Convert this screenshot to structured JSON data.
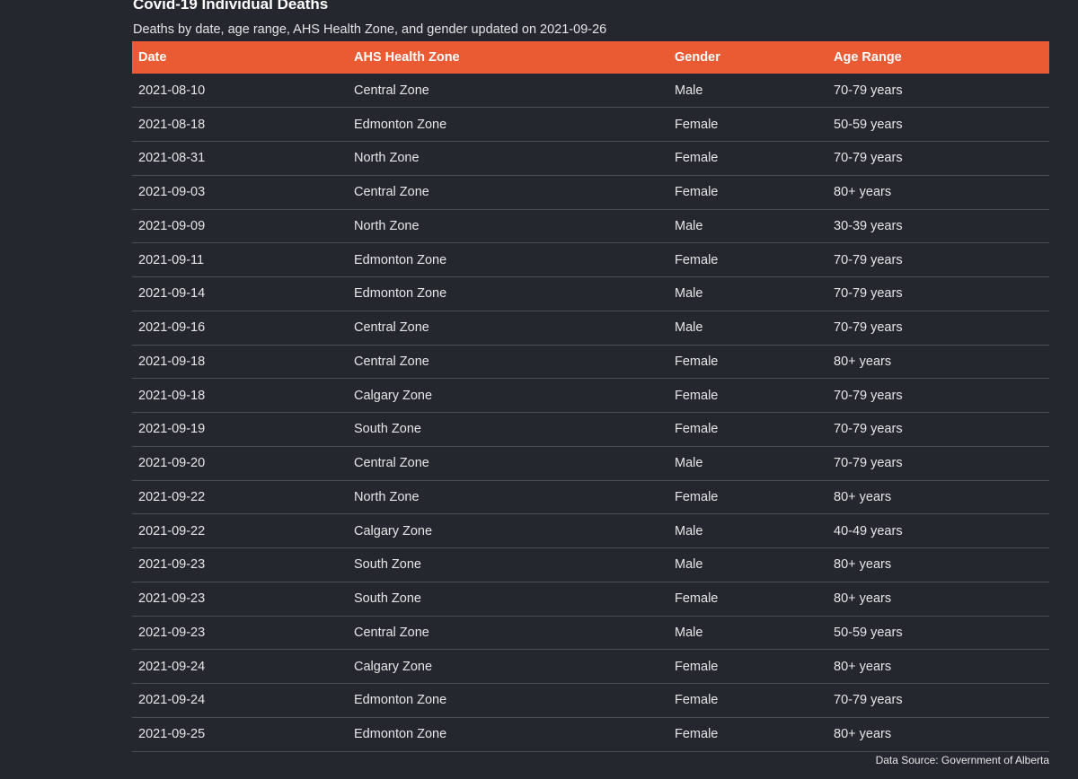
{
  "header": {
    "title": "Covid-19 Individual Deaths",
    "subtitle": "Deaths by date, age range, AHS Health Zone, and gender updated on 2021-09-26"
  },
  "table": {
    "columns": [
      "Date",
      "AHS Health Zone",
      "Gender",
      "Age Range"
    ],
    "rows": [
      [
        "2021-08-10",
        "Central Zone",
        "Male",
        "70-79 years"
      ],
      [
        "2021-08-18",
        "Edmonton Zone",
        "Female",
        "50-59 years"
      ],
      [
        "2021-08-31",
        "North Zone",
        "Female",
        "70-79 years"
      ],
      [
        "2021-09-03",
        "Central Zone",
        "Female",
        "80+ years"
      ],
      [
        "2021-09-09",
        "North Zone",
        "Male",
        "30-39 years"
      ],
      [
        "2021-09-11",
        "Edmonton Zone",
        "Female",
        "70-79 years"
      ],
      [
        "2021-09-14",
        "Edmonton Zone",
        "Male",
        "70-79 years"
      ],
      [
        "2021-09-16",
        "Central Zone",
        "Male",
        "70-79 years"
      ],
      [
        "2021-09-18",
        "Central Zone",
        "Female",
        "80+ years"
      ],
      [
        "2021-09-18",
        "Calgary Zone",
        "Female",
        "70-79 years"
      ],
      [
        "2021-09-19",
        "South Zone",
        "Female",
        "70-79 years"
      ],
      [
        "2021-09-20",
        "Central Zone",
        "Male",
        "70-79 years"
      ],
      [
        "2021-09-22",
        "North Zone",
        "Female",
        "80+ years"
      ],
      [
        "2021-09-22",
        "Calgary Zone",
        "Male",
        "40-49 years"
      ],
      [
        "2021-09-23",
        "South Zone",
        "Male",
        "80+ years"
      ],
      [
        "2021-09-23",
        "South Zone",
        "Female",
        "80+ years"
      ],
      [
        "2021-09-23",
        "Central Zone",
        "Male",
        "50-59 years"
      ],
      [
        "2021-09-24",
        "Calgary Zone",
        "Female",
        "80+ years"
      ],
      [
        "2021-09-24",
        "Edmonton Zone",
        "Female",
        "70-79 years"
      ],
      [
        "2021-09-25",
        "Edmonton Zone",
        "Female",
        "80+ years"
      ]
    ]
  },
  "footer": {
    "source": "Data Source: Government of Alberta"
  },
  "colors": {
    "background": "#24272d",
    "header_accent": "#ea5a33",
    "row_divider": "#4a4d54"
  }
}
